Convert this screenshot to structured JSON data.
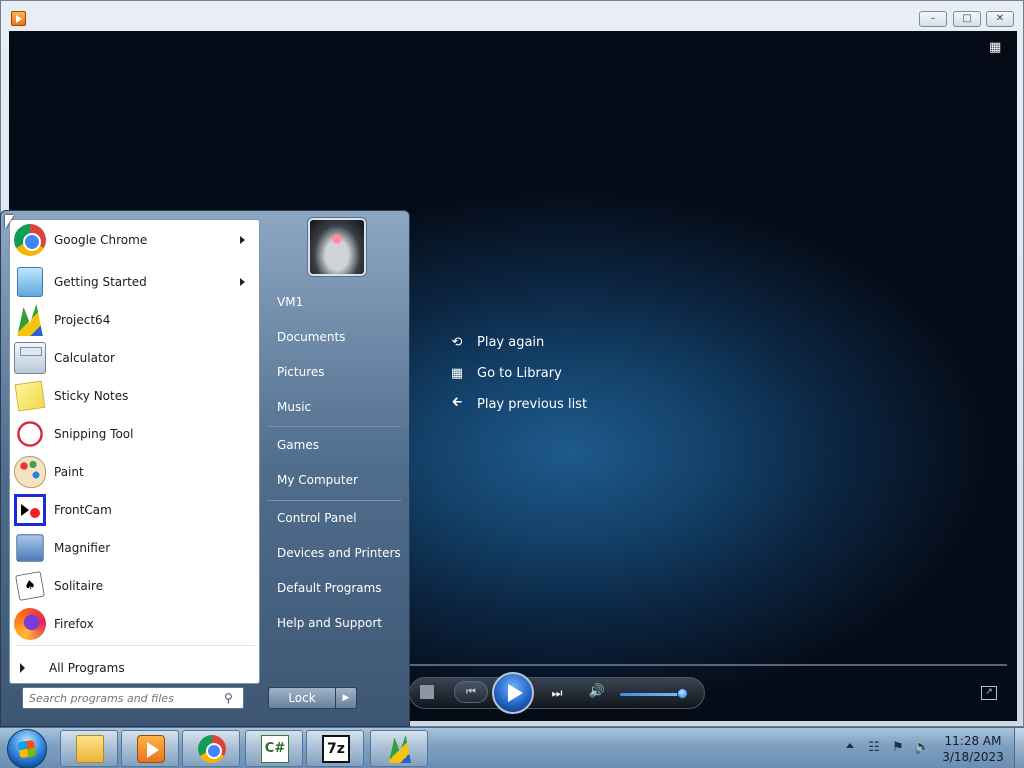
{
  "player": {
    "actions": [
      {
        "label": "Play again",
        "icon": "replay-icon"
      },
      {
        "label": "Go to Library",
        "icon": "library-icon"
      },
      {
        "label": "Play previous list",
        "icon": "back-arrow-icon"
      }
    ]
  },
  "start_menu": {
    "programs": [
      {
        "label": "Google Chrome",
        "icon": "chrome-icon",
        "submenu": true
      },
      {
        "label": "Getting Started",
        "icon": "getting-started-icon",
        "submenu": true
      },
      {
        "label": "Project64",
        "icon": "project64-icon",
        "submenu": false
      },
      {
        "label": "Calculator",
        "icon": "calculator-icon",
        "submenu": false
      },
      {
        "label": "Sticky Notes",
        "icon": "sticky-notes-icon",
        "submenu": false
      },
      {
        "label": "Snipping Tool",
        "icon": "snipping-tool-icon",
        "submenu": false
      },
      {
        "label": "Paint",
        "icon": "paint-icon",
        "submenu": false
      },
      {
        "label": "FrontCam",
        "icon": "frontcam-icon",
        "submenu": false
      },
      {
        "label": "Magnifier",
        "icon": "magnifier-icon",
        "submenu": false
      },
      {
        "label": "Solitaire",
        "icon": "solitaire-icon",
        "submenu": false
      },
      {
        "label": "Firefox",
        "icon": "firefox-icon",
        "submenu": false
      }
    ],
    "all_programs": "All Programs",
    "search_placeholder": "Search programs and files",
    "right_items": [
      "VM1",
      "Documents",
      "Pictures",
      "Music",
      "Games",
      "My Computer",
      "Control Panel",
      "Devices and Printers",
      "Default Programs",
      "Help and Support"
    ],
    "lock_label": "Lock"
  },
  "taskbar": {
    "apps": [
      "explorer-icon",
      "media-player-icon",
      "chrome-icon",
      "csharp-icon",
      "7zip-icon",
      "project64-icon"
    ],
    "csharp_text": "C#",
    "sevenzip_text": "7z",
    "time": "11:28 AM",
    "date": "3/18/2023"
  },
  "colors": {
    "accent": "#1d5fbf",
    "taskbar": "#7e9fc0",
    "menu_right_pane": "#4f6d8c"
  }
}
